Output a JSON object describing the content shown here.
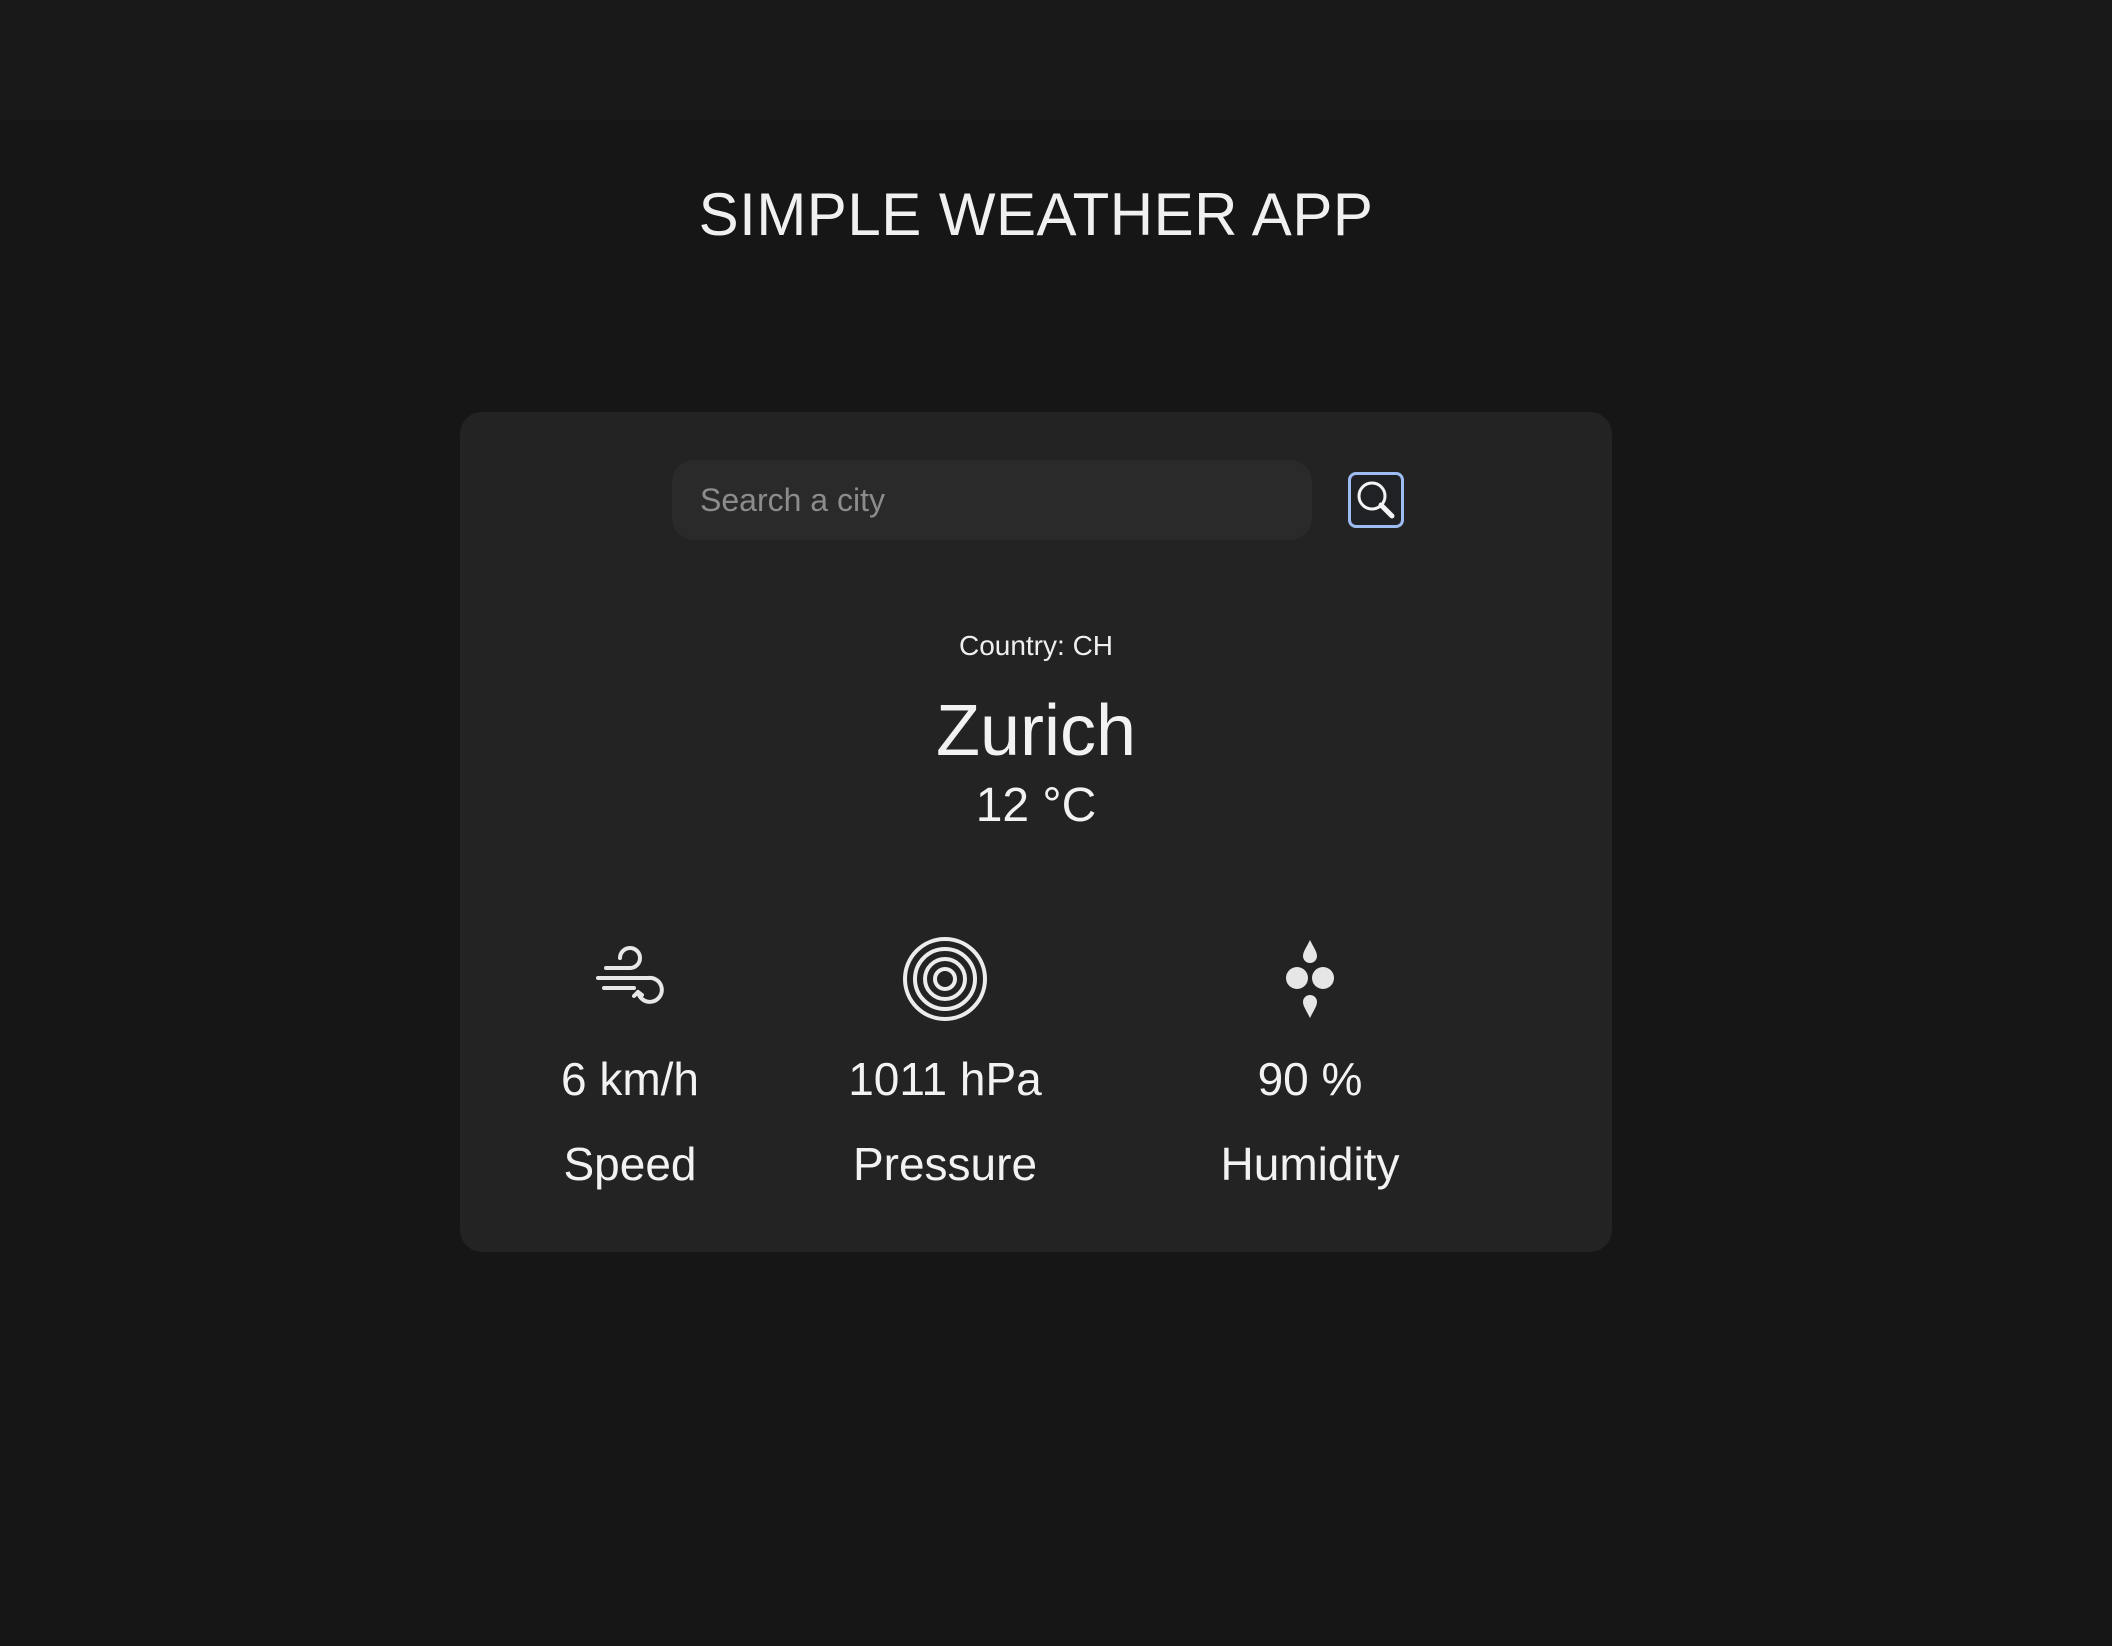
{
  "header": {
    "title": "SIMPLE WEATHER APP"
  },
  "search": {
    "placeholder": "Search a city",
    "value": "",
    "button_icon": "search-icon",
    "button_border_color": "#9dbcf2"
  },
  "weather": {
    "country": "Country: CH",
    "city": "Zurich",
    "temperature": "12 °C"
  },
  "stats": [
    {
      "icon": "wind-icon",
      "value": "6 km/h",
      "label": "Speed"
    },
    {
      "icon": "pressure-icon",
      "value": "1011 hPa",
      "label": "Pressure"
    },
    {
      "icon": "humidity-icon",
      "value": "90 %",
      "label": "Humidity"
    }
  ],
  "colors": {
    "background": "#161616",
    "card": "#232323",
    "input": "#2a2a2a",
    "text": "#f2f2f2"
  }
}
